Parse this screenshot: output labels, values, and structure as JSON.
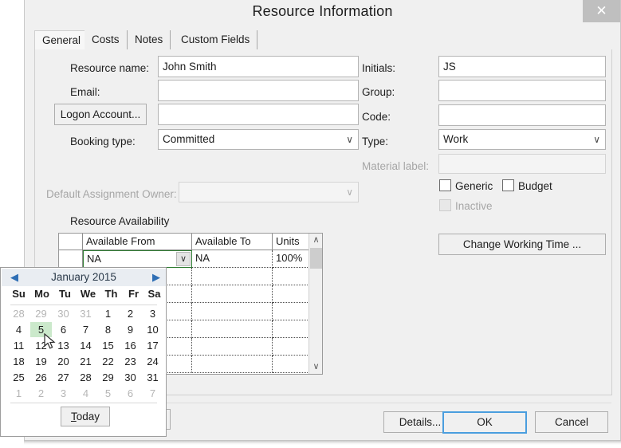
{
  "window": {
    "title": "Resource Information",
    "close_icon": "close-icon",
    "close_glyph": "✕"
  },
  "tabs": [
    {
      "label": "General",
      "active": true
    },
    {
      "label": "Costs",
      "active": false
    },
    {
      "label": "Notes",
      "active": false
    },
    {
      "label": "Custom Fields",
      "active": false
    }
  ],
  "form": {
    "left": {
      "resource_name_label": "Resource name:",
      "resource_name_value": "John Smith",
      "email_label": "Email:",
      "email_value": "",
      "logon_account_button": "Logon Account...",
      "logon_account_value": "",
      "booking_type_label": "Booking type:",
      "booking_type_value": "Committed",
      "default_owner_label": "Default Assignment Owner:",
      "default_owner_value": ""
    },
    "right": {
      "initials_label": "Initials:",
      "initials_value": "JS",
      "group_label": "Group:",
      "group_value": "",
      "code_label": "Code:",
      "code_value": "",
      "type_label": "Type:",
      "type_value": "Work",
      "material_label_label": "Material label:",
      "material_label_value": "",
      "generic_checkbox": "Generic",
      "budget_checkbox": "Budget",
      "inactive_checkbox": "Inactive",
      "change_working_time_button": "Change Working Time ..."
    }
  },
  "availability": {
    "section_label": "Resource Availability",
    "columns": [
      "",
      "Available From",
      "Available To",
      "Units"
    ],
    "rows": [
      {
        "from": "NA",
        "to": "NA",
        "units": "100%"
      },
      {
        "from": "",
        "to": "",
        "units": ""
      },
      {
        "from": "",
        "to": "",
        "units": ""
      },
      {
        "from": "",
        "to": "",
        "units": ""
      },
      {
        "from": "",
        "to": "",
        "units": ""
      },
      {
        "from": "",
        "to": "",
        "units": ""
      },
      {
        "from": "",
        "to": "",
        "units": ""
      }
    ],
    "scroll_up_glyph": "∧",
    "scroll_down_glyph": "∨",
    "cell_dropdown_glyph": "∨"
  },
  "calendar": {
    "month_title": "January 2015",
    "prev_glyph": "◀",
    "next_glyph": "▶",
    "day_headers": [
      "Su",
      "Mo",
      "Tu",
      "We",
      "Th",
      "Fr",
      "Sa"
    ],
    "selected_day": 5,
    "today_button": "Today",
    "weeks": [
      [
        {
          "d": "28",
          "o": true
        },
        {
          "d": "29",
          "o": true
        },
        {
          "d": "30",
          "o": true
        },
        {
          "d": "31",
          "o": true
        },
        {
          "d": "1",
          "o": false
        },
        {
          "d": "2",
          "o": false
        },
        {
          "d": "3",
          "o": false
        }
      ],
      [
        {
          "d": "4",
          "o": false
        },
        {
          "d": "5",
          "o": false,
          "sel": true
        },
        {
          "d": "6",
          "o": false
        },
        {
          "d": "7",
          "o": false
        },
        {
          "d": "8",
          "o": false
        },
        {
          "d": "9",
          "o": false
        },
        {
          "d": "10",
          "o": false
        }
      ],
      [
        {
          "d": "11",
          "o": false
        },
        {
          "d": "12",
          "o": false
        },
        {
          "d": "13",
          "o": false
        },
        {
          "d": "14",
          "o": false
        },
        {
          "d": "15",
          "o": false
        },
        {
          "d": "16",
          "o": false
        },
        {
          "d": "17",
          "o": false
        }
      ],
      [
        {
          "d": "18",
          "o": false
        },
        {
          "d": "19",
          "o": false
        },
        {
          "d": "20",
          "o": false
        },
        {
          "d": "21",
          "o": false
        },
        {
          "d": "22",
          "o": false
        },
        {
          "d": "23",
          "o": false
        },
        {
          "d": "24",
          "o": false
        }
      ],
      [
        {
          "d": "25",
          "o": false
        },
        {
          "d": "26",
          "o": false
        },
        {
          "d": "27",
          "o": false
        },
        {
          "d": "28",
          "o": false
        },
        {
          "d": "29",
          "o": false
        },
        {
          "d": "30",
          "o": false
        },
        {
          "d": "31",
          "o": false
        }
      ],
      [
        {
          "d": "1",
          "o": true
        },
        {
          "d": "2",
          "o": true
        },
        {
          "d": "3",
          "o": true
        },
        {
          "d": "4",
          "o": true
        },
        {
          "d": "5",
          "o": true
        },
        {
          "d": "6",
          "o": true
        },
        {
          "d": "7",
          "o": true
        }
      ]
    ]
  },
  "footer": {
    "details_button": "Details...",
    "ok_button": "OK",
    "cancel_button": "Cancel"
  },
  "colors": {
    "dialog_bg": "#f0f0f0",
    "accent_focus": "#4a9ede",
    "cell_active_border": "#2f7d32",
    "calendar_selected": "#cbe9cb",
    "calendar_header": "#e9edf2",
    "nav_arrow": "#2f6fb5"
  }
}
